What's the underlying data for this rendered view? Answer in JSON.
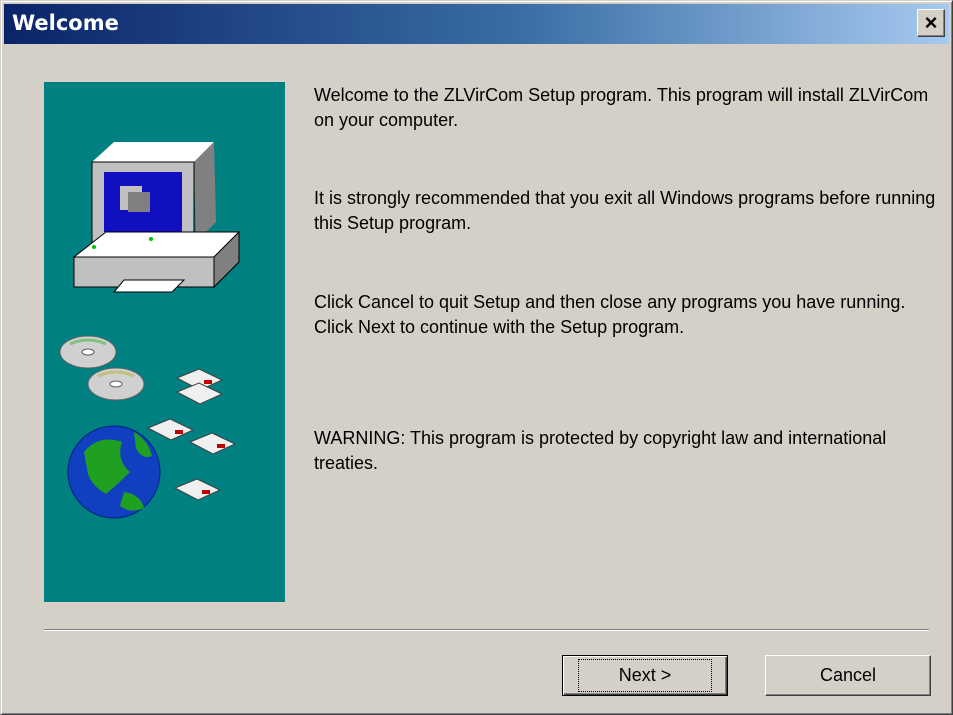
{
  "window": {
    "title": "Welcome",
    "close_label": "×"
  },
  "content": {
    "paragraph1": "Welcome to the ZLVirCom Setup program. This program will install ZLVirCom on your computer.",
    "paragraph2": "It is strongly recommended that you exit all Windows programs before running this Setup program.",
    "paragraph3": "Click Cancel to quit Setup and then close any programs you have running. Click Next to continue with the Setup program.",
    "paragraph4": "WARNING: This program is protected by copyright law and international treaties."
  },
  "buttons": {
    "next_label": "Next >",
    "cancel_label": "Cancel"
  },
  "icons": {
    "illustration": "setup-illustration",
    "close": "close-icon"
  },
  "colors": {
    "side_panel": "#008080",
    "title_gradient_start": "#0a246a",
    "title_gradient_end": "#a6caf0",
    "dialog_face": "#d4d0c8"
  }
}
